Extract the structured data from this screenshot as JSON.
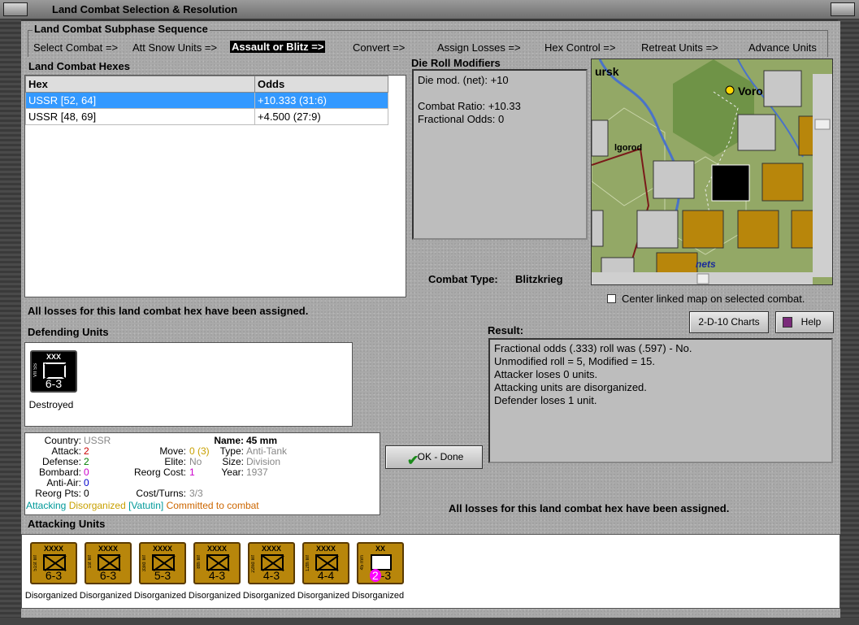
{
  "window": {
    "title": "Land Combat Selection & Resolution"
  },
  "phase": {
    "group_title": "Land Combat Subphase Sequence",
    "items": [
      {
        "label": "Select Combat =>"
      },
      {
        "label": "Att Snow Units =>"
      },
      {
        "label": "Assault or Blitz =>",
        "selected": true
      },
      {
        "label": "Convert =>"
      },
      {
        "label": "Assign Losses =>"
      },
      {
        "label": "Hex Control =>"
      },
      {
        "label": "Retreat Units =>"
      },
      {
        "label": "Advance Units"
      }
    ]
  },
  "hexes": {
    "title": "Land Combat Hexes",
    "columns": [
      "Hex",
      "Odds"
    ],
    "rows": [
      {
        "hex": "USSR [52, 64]",
        "odds": "+10.333 (31:6)",
        "selected": true
      },
      {
        "hex": "USSR [48, 69]",
        "odds": "+4.500 (27:9)"
      }
    ]
  },
  "modifiers": {
    "title": "Die Roll Modifiers",
    "line1": "Die mod. (net): +10",
    "line2": "Combat Ratio: +10.33",
    "line3": "Fractional Odds: 0"
  },
  "combat_type": {
    "label": "Combat Type:",
    "value": "Blitzkrieg"
  },
  "map": {
    "labels": [
      "ursk",
      "Voro",
      "lgorod",
      "nets"
    ],
    "center_checkbox": "Center linked map on selected combat."
  },
  "status_top": "All losses for this land combat hex have been assigned.",
  "status_bottom": "All losses for this land combat hex have been assigned.",
  "buttons": {
    "charts": "2-D-10 Charts",
    "help": "Help",
    "ok": "OK - Done"
  },
  "result": {
    "title": "Result:",
    "lines": [
      "Fractional odds (.333) roll was (.597)  - No.",
      "Unmodified roll = 5, Modified = 15.",
      "Attacker loses 0 units.",
      "Attacking units are disorganized.",
      "Defender loses 1 unit."
    ]
  },
  "defending": {
    "title": "Defending Units",
    "unit": {
      "size": "XXX",
      "name": "VII SS",
      "strength": "6-3",
      "status": "Destroyed"
    }
  },
  "unit_info": {
    "country_label": "Country:",
    "country": "USSR",
    "name_label": "Name:",
    "name": "45 mm",
    "attack_label": "Attack:",
    "attack": "2",
    "defense_label": "Defense:",
    "defense": "2",
    "bombard_label": "Bombard:",
    "bombard": "0",
    "antiair_label": "Anti-Air:",
    "antiair": "0",
    "reorg_pts_label": "Reorg Pts:",
    "reorg_pts": "0",
    "move_label": "Move:",
    "move": "0 (3)",
    "elite_label": "Elite:",
    "elite": "No",
    "reorg_cost_label": "Reorg Cost:",
    "reorg_cost": "1",
    "cost_turns_label": "Cost/Turns:",
    "cost_turns": "3/3",
    "type_label": "Type:",
    "type": "Anti-Tank",
    "size_label": "Size:",
    "size": "Division",
    "year_label": "Year:",
    "year": "1937",
    "status_attacking": "Attacking",
    "status_disorganized": "Disorganized",
    "status_commander": "[Vatutin]",
    "status_committed": "Committed to combat"
  },
  "attacking": {
    "title": "Attacking Units",
    "units": [
      {
        "size": "XXXX",
        "name": "51st Inf",
        "strength": "6-3",
        "status": "Disorganized"
      },
      {
        "size": "XXXX",
        "name": "1st Inf",
        "strength": "6-3",
        "status": "Disorganized"
      },
      {
        "size": "XXXX",
        "name": "33rd Inf",
        "strength": "5-3",
        "status": "Disorganized"
      },
      {
        "size": "XXXX",
        "name": "8th Inf",
        "strength": "4-3",
        "status": "Disorganized"
      },
      {
        "size": "XXXX",
        "name": "22nd Inf",
        "strength": "4-3",
        "status": "Disorganized"
      },
      {
        "size": "XXXX",
        "name": "12th Inf",
        "strength": "4-4",
        "status": "Disorganized"
      },
      {
        "size": "XX",
        "name": "45 mm",
        "strength_a": "2",
        "strength_b": "-3",
        "status": "Disorganized"
      }
    ]
  },
  "colors": {
    "accent_select": "#3399ff",
    "counter_brown": "#b8860b",
    "attack_red": "#cc0000",
    "defense_green": "#008000",
    "bombard_magenta": "#cc00cc",
    "antiair_blue": "#0000cc",
    "committed_orange": "#cc6600",
    "attacking_teal": "#009999",
    "disorg_gold": "#c8a000"
  }
}
